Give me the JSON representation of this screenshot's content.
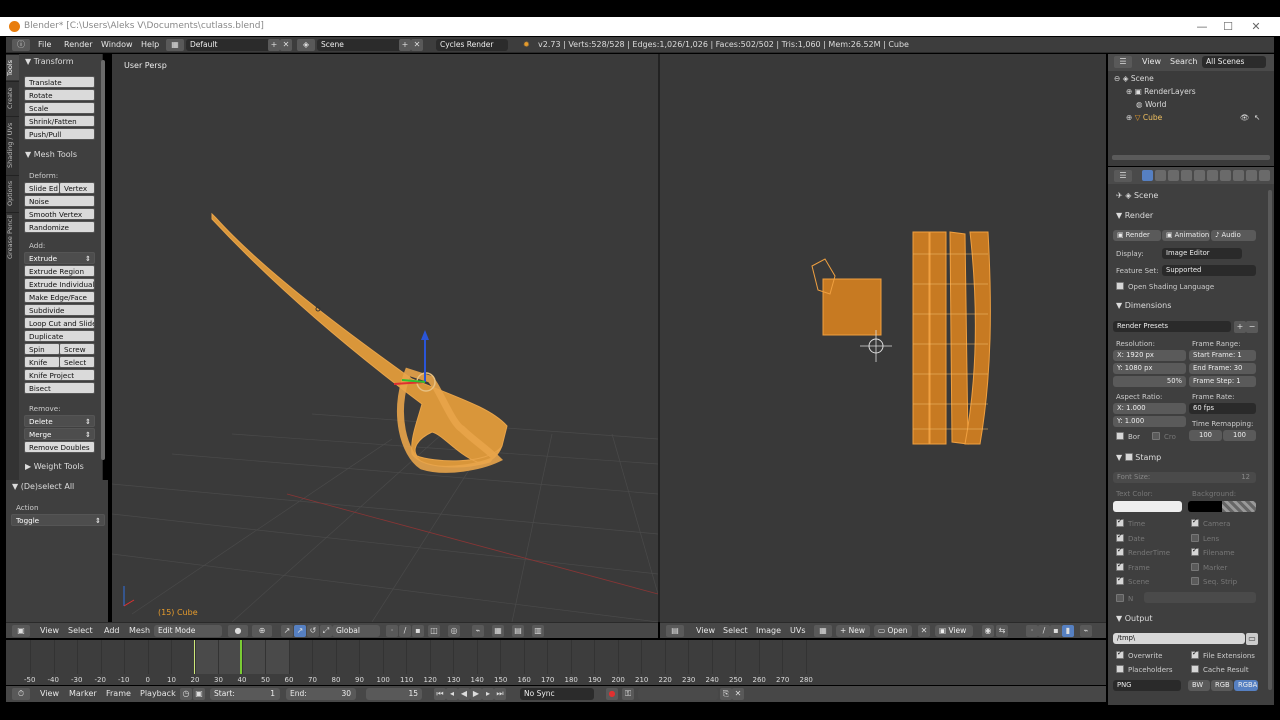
{
  "window": {
    "title": "Blender* [C:\\Users\\Aleks V\\Documents\\cutlass.blend]"
  },
  "menubar": {
    "menus": [
      "File",
      "Render",
      "Window",
      "Help"
    ],
    "layout": "Default",
    "scene": "Scene",
    "engine": "Cycles Render",
    "stats": "v2.73 | Verts:528/528 | Edges:1,026/1,026 | Faces:502/502 | Tris:1,060 | Mem:26.52M | Cube"
  },
  "shelf": {
    "tabs": [
      "Tools",
      "Create",
      "Shading / UVs",
      "Options",
      "Grease Pencil"
    ],
    "transform": {
      "title": "Transform",
      "buttons": [
        "Translate",
        "Rotate",
        "Scale",
        "Shrink/Fatten",
        "Push/Pull"
      ]
    },
    "mesh_tools": {
      "title": "Mesh Tools",
      "deform_label": "Deform:",
      "slide_edge": "Slide Ed",
      "vertex": "Vertex",
      "deform": [
        "Noise",
        "Smooth Vertex",
        "Randomize"
      ],
      "add_label": "Add:",
      "extrude": "Extrude",
      "add": [
        "Extrude Region",
        "Extrude Individual",
        "Make Edge/Face",
        "Subdivide",
        "Loop Cut and Slide",
        "Duplicate"
      ],
      "spin": "Spin",
      "screw": "Screw",
      "knife": "Knife",
      "select": "Select",
      "add2": [
        "Knife Project",
        "Bisect"
      ],
      "remove_label": "Remove:",
      "delete": "Delete",
      "merge": "Merge",
      "remove_doubles": "Remove Doubles"
    },
    "weight_tools": "Weight Tools",
    "operator": {
      "title": "(De)select All",
      "action_label": "Action",
      "action_value": "Toggle"
    }
  },
  "view3d": {
    "label": "User Persp",
    "object": "(15) Cube",
    "header": {
      "menus": [
        "View",
        "Select",
        "Add",
        "Mesh"
      ],
      "mode": "Edit Mode",
      "orientation": "Global"
    }
  },
  "uv": {
    "header": {
      "menus": [
        "View",
        "Select",
        "Image",
        "UVs"
      ],
      "new": "New",
      "open": "Open",
      "view": "View"
    }
  },
  "outliner": {
    "header": {
      "view": "View",
      "search": "Search",
      "filter": "All Scenes"
    },
    "items": [
      "Scene",
      "RenderLayers",
      "World",
      "Cube"
    ]
  },
  "properties": {
    "context": "Scene",
    "render": {
      "title": "Render",
      "render_btn": "Render",
      "animation_btn": "Animation",
      "audio_btn": "Audio",
      "display_label": "Display:",
      "display_value": "Image Editor",
      "feature_label": "Feature Set:",
      "feature_value": "Supported",
      "osl": "Open Shading Language"
    },
    "dimensions": {
      "title": "Dimensions",
      "presets": "Render Presets",
      "resolution_label": "Resolution:",
      "res_x": "X:    1920 px",
      "res_y": "Y:    1080 px",
      "res_pct": "50%",
      "frame_range_label": "Frame Range:",
      "start": "Start Frame: 1",
      "end": "End Frame: 30",
      "step": "Frame Step: 1",
      "aspect_label": "Aspect Ratio:",
      "asp_x": "X:      1.000",
      "asp_y": "Y:      1.000",
      "frame_rate_label": "Frame Rate:",
      "frame_rate": "60 fps",
      "bor": "Bor",
      "cro": "Cro",
      "remap_label": "Time Remapping:",
      "remap_old": "100",
      "remap_new": "100"
    },
    "stamp": {
      "title": "Stamp",
      "font_size": "Font Size:",
      "font_size_val": "12",
      "text_color": "Text Color:",
      "background": "Background:",
      "left": [
        "Time",
        "Date",
        "RenderTime",
        "Frame",
        "Scene"
      ],
      "right": [
        "Camera",
        "Lens",
        "Filename",
        "Marker",
        "Seq. Strip"
      ],
      "note": "N"
    },
    "output": {
      "title": "Output",
      "path": "/tmp\\",
      "overwrite": "Overwrite",
      "file_ext": "File Extensions",
      "placeholders": "Placeholders",
      "cache": "Cache Result",
      "format": "PNG",
      "bw": "BW",
      "rgb": "RGB",
      "rgba": "RGBA"
    }
  },
  "timeline": {
    "ticks": [
      "-50",
      "-40",
      "-30",
      "-20",
      "-10",
      "0",
      "10",
      "20",
      "30",
      "40",
      "50",
      "60",
      "70",
      "80",
      "90",
      "100",
      "110",
      "120",
      "130",
      "140",
      "150",
      "160",
      "170",
      "180",
      "190",
      "200",
      "210",
      "220",
      "230",
      "240",
      "250",
      "260",
      "270",
      "280"
    ],
    "menus": [
      "View",
      "Marker",
      "Frame",
      "Playback"
    ],
    "start": "Start:",
    "start_val": "1",
    "end": "End:",
    "end_val": "30",
    "current": "15",
    "sync": "No Sync"
  },
  "colors": {
    "accent": "#e59b2c",
    "selected": "#5680c2",
    "viewport": "#3a3a3a"
  }
}
